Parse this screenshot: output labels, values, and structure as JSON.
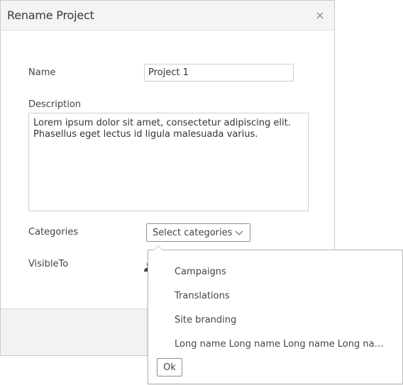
{
  "dialog": {
    "title": "Rename Project",
    "close_label": "×"
  },
  "form": {
    "name_label": "Name",
    "name_value": "Project 1",
    "description_label": "Description",
    "description_value": "Lorem ipsum dolor sit amet, consectetur adipiscing elit.\nPhasellus eget lectus id ligula malesuada varius.",
    "categories_label": "Categories",
    "categories_button": "Select categories",
    "visible_to_label": "VisibleTo"
  },
  "dropdown": {
    "options": [
      "Campaigns",
      "Translations",
      "Site branding",
      "Long name Long name Long name Long name L..."
    ],
    "ok_label": "Ok"
  },
  "icons": {
    "close": "close-icon",
    "chevron": "chevron-down-icon",
    "visibility": "user-icon"
  }
}
